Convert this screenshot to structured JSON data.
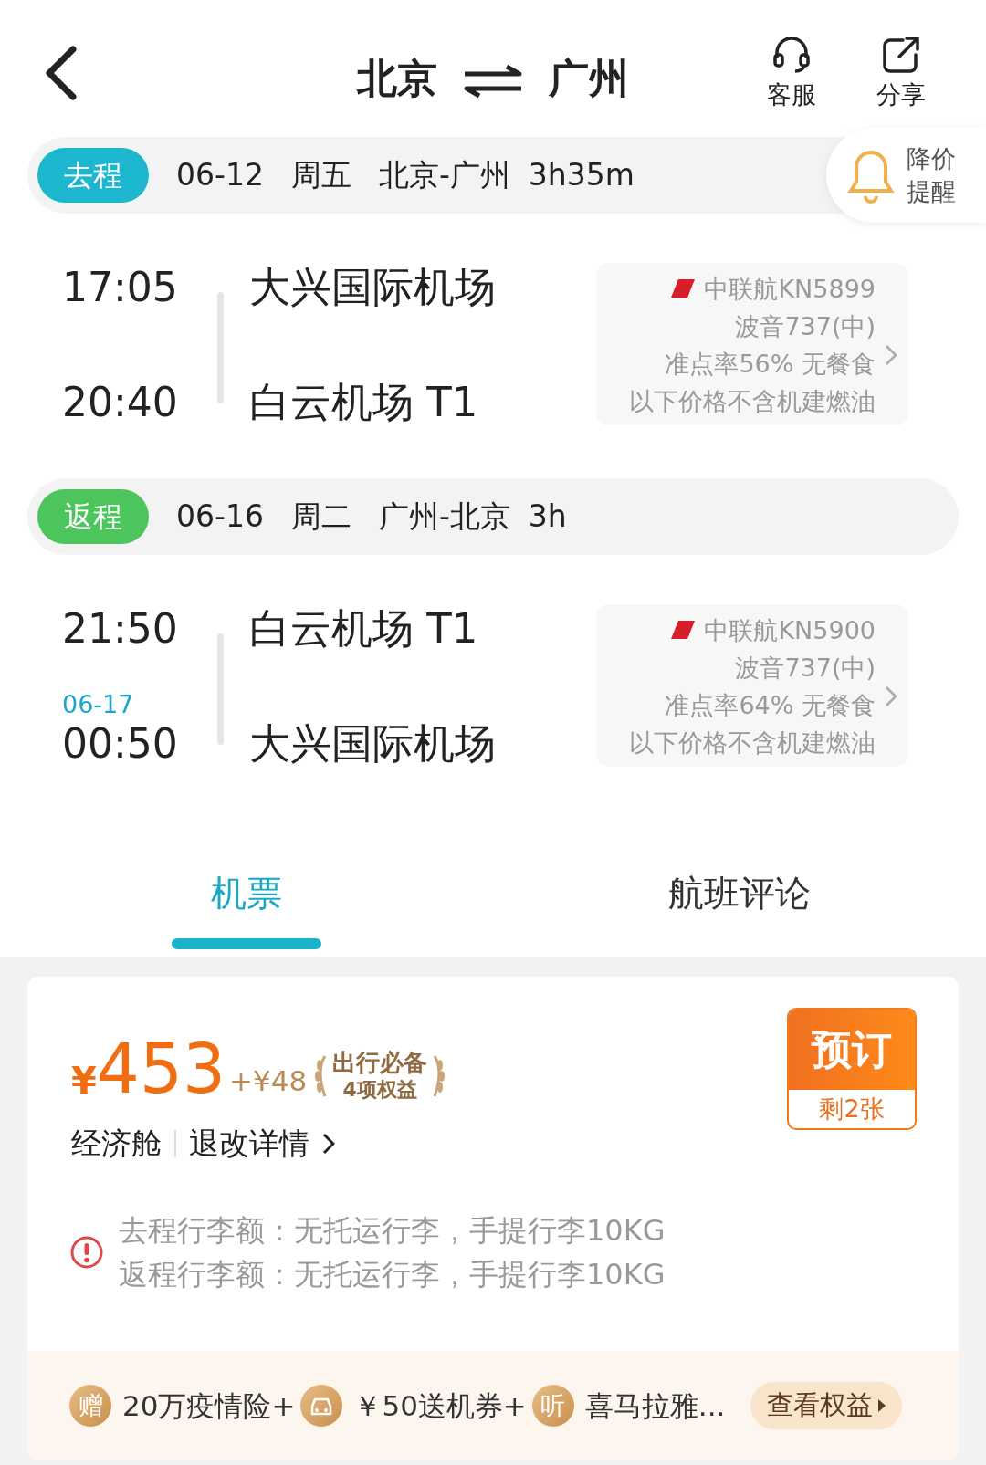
{
  "header": {
    "from": "北京",
    "to": "广州",
    "actions": [
      {
        "kind": "headset",
        "label": "客服"
      },
      {
        "kind": "share",
        "label": "分享"
      }
    ]
  },
  "price_alert": {
    "line1": "降价",
    "line2": "提醒"
  },
  "legs": [
    {
      "tag": "去程",
      "color": "#1cb6cf",
      "date": "06-12",
      "weekday": "周五",
      "route": "北京-广州",
      "duration": "3h35m",
      "dep_time": "17:05",
      "arr_time": "20:40",
      "dep_airport": "大兴国际机场",
      "arr_airport": "白云机场 T1",
      "info": [
        "中联航KN5899",
        "波音737(中)",
        "准点率56% 无餐食",
        "以下价格不含机建燃油"
      ]
    },
    {
      "tag": "返程",
      "color": "#4cc65c",
      "date": "06-16",
      "weekday": "周二",
      "route": "广州-北京",
      "duration": "3h",
      "dep_time": "21:50",
      "arr_date": "06-17",
      "arr_time": "00:50",
      "dep_airport": "白云机场 T1",
      "arr_airport": "大兴国际机场",
      "info": [
        "中联航KN5900",
        "波音737(中)",
        "准点率64% 无餐食",
        "以下价格不含机建燃油"
      ]
    }
  ],
  "tabs": [
    {
      "label": "机票",
      "selected": true
    },
    {
      "label": "航班评论",
      "selected": false
    }
  ],
  "offer": {
    "currency": "¥",
    "amount": "453",
    "addon": "+¥48",
    "perk_title": "出行必备",
    "perk_sub": "4项权益",
    "cabin": "经济舱",
    "rules_link": "退改详情",
    "book": "预订",
    "remaining": "剩2张",
    "baggage": [
      "去程行李额：无托运行李，手提行李10KG",
      "返程行李额：无托运行李，手提行李10KG"
    ],
    "benefits": [
      {
        "kind": "glyph",
        "glyph": "赠",
        "text": "20万疫情险+"
      },
      {
        "kind": "car",
        "text": "￥50送机券+"
      },
      {
        "kind": "glyph",
        "glyph": "听",
        "text": "喜马拉雅..."
      }
    ],
    "view_button": "查看权益"
  }
}
